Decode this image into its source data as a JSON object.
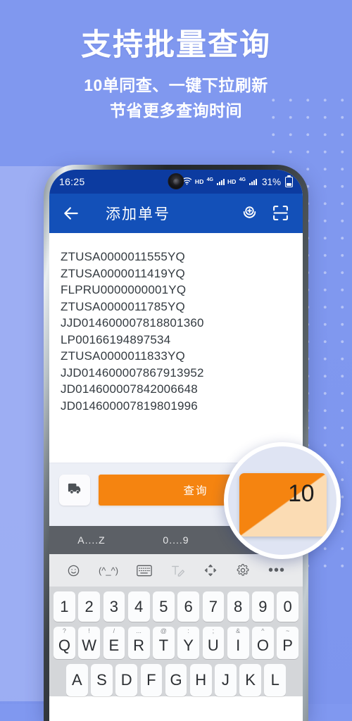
{
  "promo": {
    "headline": "支持批量查询",
    "sub_line1": "10单同查、一键下拉刷新",
    "sub_line2": "节省更多查询时间"
  },
  "phone": {
    "status_bar": {
      "time": "16:25",
      "wifi_icon": "wifi-icon",
      "hd_label_1": "HD",
      "network_1": "4G",
      "hd_label_2": "HD",
      "network_2": "4G",
      "battery_percent": "31%",
      "battery_icon": "battery-icon",
      "punch_hole": "front-camera"
    },
    "app_bar": {
      "back_icon": "back-arrow-icon",
      "title": "添加单号",
      "voice_icon": "voice-add-icon",
      "scan_icon": "scan-code-icon"
    },
    "tracking_list": [
      "ZTUSA0000011555YQ",
      "ZTUSA0000011419YQ",
      "FLPRU0000000001YQ",
      "ZTUSA0000011785YQ",
      "JJD014600007818801360",
      "LP00166194897534",
      "ZTUSA0000011833YQ",
      "JJD014600007867913952",
      "JD014600007842006648",
      "JD014600007819801996"
    ],
    "action_bar": {
      "carrier_icon": "truck-icon",
      "query_label": "查询",
      "query_color": "#f58410"
    },
    "keyboard": {
      "suggestions": [
        "A....Z",
        "0....9"
      ],
      "tools": [
        {
          "name": "emoji-icon",
          "glyph": "☺"
        },
        {
          "name": "kaomoji-icon",
          "glyph": "(^_^)"
        },
        {
          "name": "keyboard-layout-icon",
          "glyph": "⌨"
        },
        {
          "name": "handwriting-icon",
          "glyph": "T✎"
        },
        {
          "name": "cursor-move-icon",
          "glyph": "✛"
        },
        {
          "name": "settings-gear-icon",
          "glyph": "⚙"
        },
        {
          "name": "more-options-icon",
          "glyph": "•••"
        }
      ],
      "number_row": [
        "1",
        "2",
        "3",
        "4",
        "5",
        "6",
        "7",
        "8",
        "9",
        "0"
      ],
      "alpha_row": [
        {
          "key": "Q",
          "sup": "?"
        },
        {
          "key": "W",
          "sup": "!"
        },
        {
          "key": "E",
          "sup": "/"
        },
        {
          "key": "R",
          "sup": "..."
        },
        {
          "key": "T",
          "sup": "@"
        },
        {
          "key": "Y",
          "sup": ":"
        },
        {
          "key": "U",
          "sup": ";"
        },
        {
          "key": "I",
          "sup": "&"
        },
        {
          "key": "O",
          "sup": "^"
        },
        {
          "key": "P",
          "sup": "~"
        }
      ],
      "third_row": [
        "A",
        "S",
        "D",
        "F",
        "G",
        "H",
        "J",
        "K",
        "L"
      ]
    }
  },
  "magnifier": {
    "badge_count": "10",
    "badge_color": "#f58410"
  }
}
